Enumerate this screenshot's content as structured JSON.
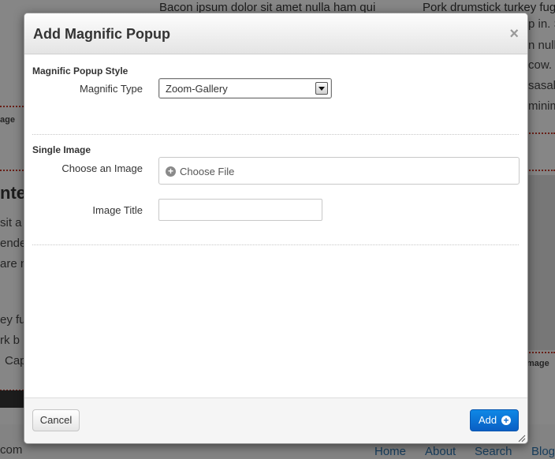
{
  "background": {
    "top_texts": [
      "Bacon ipsum dolor sit amet nulla ham qui",
      "Pork drumstick turkey fugiat"
    ],
    "right_snippets": [
      "p in. S",
      "n nulla",
      "cow. B",
      "sasala",
      "minim"
    ],
    "left_snippets": [
      "nte",
      "sit a",
      "ende",
      "are n",
      "ey fu",
      "rk b",
      "Cap"
    ],
    "left_small": "age",
    "right_small": "mage",
    "footer_left": "com",
    "nav": [
      "Home",
      "About",
      "Search",
      "Blog"
    ]
  },
  "modal": {
    "title": "Add Magnific Popup",
    "close_glyph": "×",
    "style_section": {
      "title": "Magnific Popup Style",
      "type_label": "Magnific Type",
      "type_value": "Zoom-Gallery"
    },
    "image_section": {
      "title": "Single Image",
      "choose_label": "Choose an Image",
      "choose_button": "Choose File",
      "title_label": "Image Title",
      "title_value": ""
    },
    "footer": {
      "cancel_label": "Cancel",
      "add_label": "Add"
    }
  },
  "colors": {
    "primary_button": "#0a67cc",
    "overlay": "rgba(0,0,0,0.45)"
  },
  "icons": {
    "close": "close-icon",
    "select": "chevron-down-icon",
    "choose_file": "plus-circle-icon",
    "add": "plus-circle-icon",
    "resize": "resize-handle-icon"
  }
}
